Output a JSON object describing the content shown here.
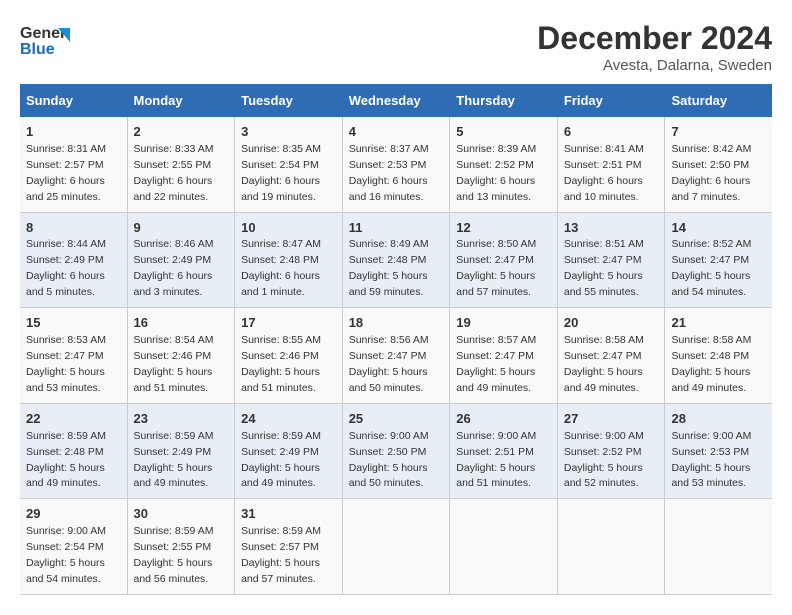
{
  "header": {
    "logo_line1": "General",
    "logo_line2": "Blue",
    "title": "December 2024",
    "subtitle": "Avesta, Dalarna, Sweden"
  },
  "days_of_week": [
    "Sunday",
    "Monday",
    "Tuesday",
    "Wednesday",
    "Thursday",
    "Friday",
    "Saturday"
  ],
  "weeks": [
    [
      {
        "num": "1",
        "info": "Sunrise: 8:31 AM\nSunset: 2:57 PM\nDaylight: 6 hours\nand 25 minutes."
      },
      {
        "num": "2",
        "info": "Sunrise: 8:33 AM\nSunset: 2:55 PM\nDaylight: 6 hours\nand 22 minutes."
      },
      {
        "num": "3",
        "info": "Sunrise: 8:35 AM\nSunset: 2:54 PM\nDaylight: 6 hours\nand 19 minutes."
      },
      {
        "num": "4",
        "info": "Sunrise: 8:37 AM\nSunset: 2:53 PM\nDaylight: 6 hours\nand 16 minutes."
      },
      {
        "num": "5",
        "info": "Sunrise: 8:39 AM\nSunset: 2:52 PM\nDaylight: 6 hours\nand 13 minutes."
      },
      {
        "num": "6",
        "info": "Sunrise: 8:41 AM\nSunset: 2:51 PM\nDaylight: 6 hours\nand 10 minutes."
      },
      {
        "num": "7",
        "info": "Sunrise: 8:42 AM\nSunset: 2:50 PM\nDaylight: 6 hours\nand 7 minutes."
      }
    ],
    [
      {
        "num": "8",
        "info": "Sunrise: 8:44 AM\nSunset: 2:49 PM\nDaylight: 6 hours\nand 5 minutes."
      },
      {
        "num": "9",
        "info": "Sunrise: 8:46 AM\nSunset: 2:49 PM\nDaylight: 6 hours\nand 3 minutes."
      },
      {
        "num": "10",
        "info": "Sunrise: 8:47 AM\nSunset: 2:48 PM\nDaylight: 6 hours\nand 1 minute."
      },
      {
        "num": "11",
        "info": "Sunrise: 8:49 AM\nSunset: 2:48 PM\nDaylight: 5 hours\nand 59 minutes."
      },
      {
        "num": "12",
        "info": "Sunrise: 8:50 AM\nSunset: 2:47 PM\nDaylight: 5 hours\nand 57 minutes."
      },
      {
        "num": "13",
        "info": "Sunrise: 8:51 AM\nSunset: 2:47 PM\nDaylight: 5 hours\nand 55 minutes."
      },
      {
        "num": "14",
        "info": "Sunrise: 8:52 AM\nSunset: 2:47 PM\nDaylight: 5 hours\nand 54 minutes."
      }
    ],
    [
      {
        "num": "15",
        "info": "Sunrise: 8:53 AM\nSunset: 2:47 PM\nDaylight: 5 hours\nand 53 minutes."
      },
      {
        "num": "16",
        "info": "Sunrise: 8:54 AM\nSunset: 2:46 PM\nDaylight: 5 hours\nand 51 minutes."
      },
      {
        "num": "17",
        "info": "Sunrise: 8:55 AM\nSunset: 2:46 PM\nDaylight: 5 hours\nand 51 minutes."
      },
      {
        "num": "18",
        "info": "Sunrise: 8:56 AM\nSunset: 2:47 PM\nDaylight: 5 hours\nand 50 minutes."
      },
      {
        "num": "19",
        "info": "Sunrise: 8:57 AM\nSunset: 2:47 PM\nDaylight: 5 hours\nand 49 minutes."
      },
      {
        "num": "20",
        "info": "Sunrise: 8:58 AM\nSunset: 2:47 PM\nDaylight: 5 hours\nand 49 minutes."
      },
      {
        "num": "21",
        "info": "Sunrise: 8:58 AM\nSunset: 2:48 PM\nDaylight: 5 hours\nand 49 minutes."
      }
    ],
    [
      {
        "num": "22",
        "info": "Sunrise: 8:59 AM\nSunset: 2:48 PM\nDaylight: 5 hours\nand 49 minutes."
      },
      {
        "num": "23",
        "info": "Sunrise: 8:59 AM\nSunset: 2:49 PM\nDaylight: 5 hours\nand 49 minutes."
      },
      {
        "num": "24",
        "info": "Sunrise: 8:59 AM\nSunset: 2:49 PM\nDaylight: 5 hours\nand 49 minutes."
      },
      {
        "num": "25",
        "info": "Sunrise: 9:00 AM\nSunset: 2:50 PM\nDaylight: 5 hours\nand 50 minutes."
      },
      {
        "num": "26",
        "info": "Sunrise: 9:00 AM\nSunset: 2:51 PM\nDaylight: 5 hours\nand 51 minutes."
      },
      {
        "num": "27",
        "info": "Sunrise: 9:00 AM\nSunset: 2:52 PM\nDaylight: 5 hours\nand 52 minutes."
      },
      {
        "num": "28",
        "info": "Sunrise: 9:00 AM\nSunset: 2:53 PM\nDaylight: 5 hours\nand 53 minutes."
      }
    ],
    [
      {
        "num": "29",
        "info": "Sunrise: 9:00 AM\nSunset: 2:54 PM\nDaylight: 5 hours\nand 54 minutes."
      },
      {
        "num": "30",
        "info": "Sunrise: 8:59 AM\nSunset: 2:55 PM\nDaylight: 5 hours\nand 56 minutes."
      },
      {
        "num": "31",
        "info": "Sunrise: 8:59 AM\nSunset: 2:57 PM\nDaylight: 5 hours\nand 57 minutes."
      },
      {
        "num": "",
        "info": ""
      },
      {
        "num": "",
        "info": ""
      },
      {
        "num": "",
        "info": ""
      },
      {
        "num": "",
        "info": ""
      }
    ]
  ]
}
